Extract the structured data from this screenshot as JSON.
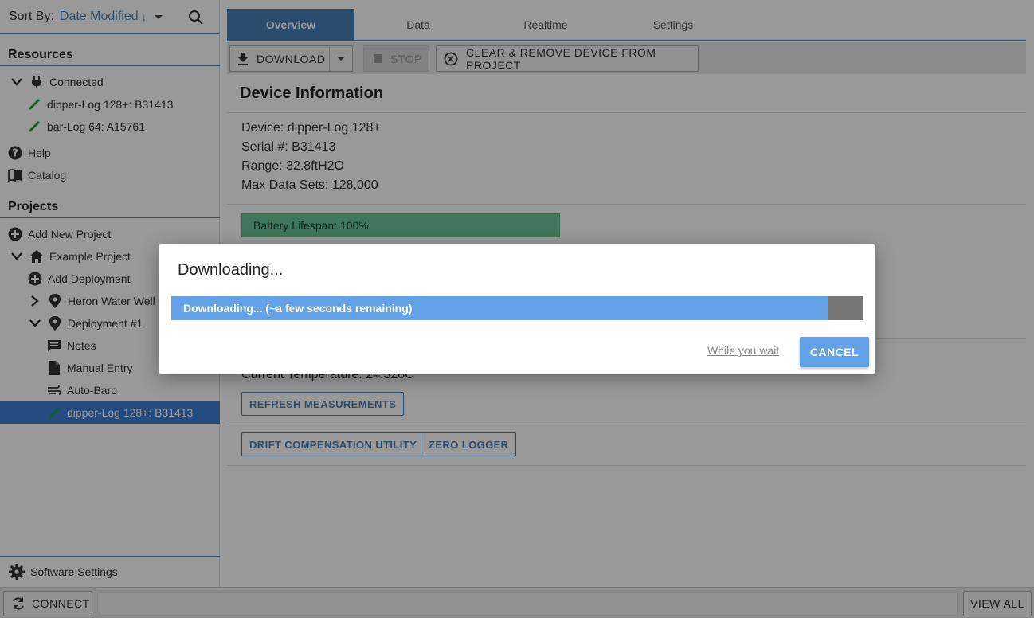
{
  "sidebar": {
    "sort_label": "Sort By:",
    "sort_value": "Date Modified",
    "sort_direction_glyph": "↓",
    "resources_title": "Resources",
    "connected_label": "Connected",
    "devices": [
      "dipper-Log 128+: B31413",
      "bar-Log 64: A15761"
    ],
    "help_label": "Help",
    "catalog_label": "Catalog",
    "projects_title": "Projects",
    "add_project_label": "Add New Project",
    "project_name": "Example Project",
    "add_deployment_label": "Add Deployment",
    "deployments": [
      "Heron Water Well",
      "Deployment #1"
    ],
    "deployment_children": [
      "Notes",
      "Manual Entry",
      "Auto-Baro"
    ],
    "selected_device": "dipper-Log 128+: B31413",
    "software_settings_label": "Software Settings"
  },
  "tabs": [
    {
      "label": "Overview",
      "active": true
    },
    {
      "label": "Data",
      "active": false
    },
    {
      "label": "Realtime",
      "active": false
    },
    {
      "label": "Settings",
      "active": false
    }
  ],
  "toolbar": {
    "download_label": "DOWNLOAD",
    "stop_label": "STOP",
    "clear_label": "CLEAR & REMOVE DEVICE FROM PROJECT"
  },
  "device_info": {
    "title": "Device Information",
    "device": "Device: dipper-Log 128+",
    "serial": "Serial #: B31413",
    "range": "Range: 32.8ftH2O",
    "max_data_sets": "Max Data Sets: 128,000",
    "battery_label": "Battery Lifespan: 100%",
    "battery_level": 1.0,
    "current_temperature": "Current Temperature: 24.328C",
    "refresh_label": "REFRESH MEASUREMENTS",
    "drift_label": "DRIFT COMPENSATION UTILITY",
    "zero_label": "ZERO LOGGER"
  },
  "bottom": {
    "connect_label": "CONNECT",
    "view_all_label": "VIEW ALL"
  },
  "dialog": {
    "title": "Downloading...",
    "progress_text": "Downloading... (~a few seconds remaining)",
    "progress_fraction": 0.95,
    "wait_link": "While you wait",
    "cancel_label": "CANCEL"
  },
  "colors": {
    "accent": "#4a7fb8",
    "selection": "#3b7dd0",
    "progress": "#63a2e6",
    "battery": "#6cc596",
    "pencil_icon": "#1e9e4a"
  },
  "icons": [
    "search-icon",
    "chevron-down-icon",
    "chevron-right-icon",
    "plug-icon",
    "pencil-icon",
    "help-icon",
    "book-icon",
    "add-circle-icon",
    "home-icon",
    "location-pin-icon",
    "notes-icon",
    "document-icon",
    "wind-icon",
    "gear-icon",
    "sync-icon",
    "download-icon",
    "stop-icon",
    "close-circle-icon"
  ]
}
